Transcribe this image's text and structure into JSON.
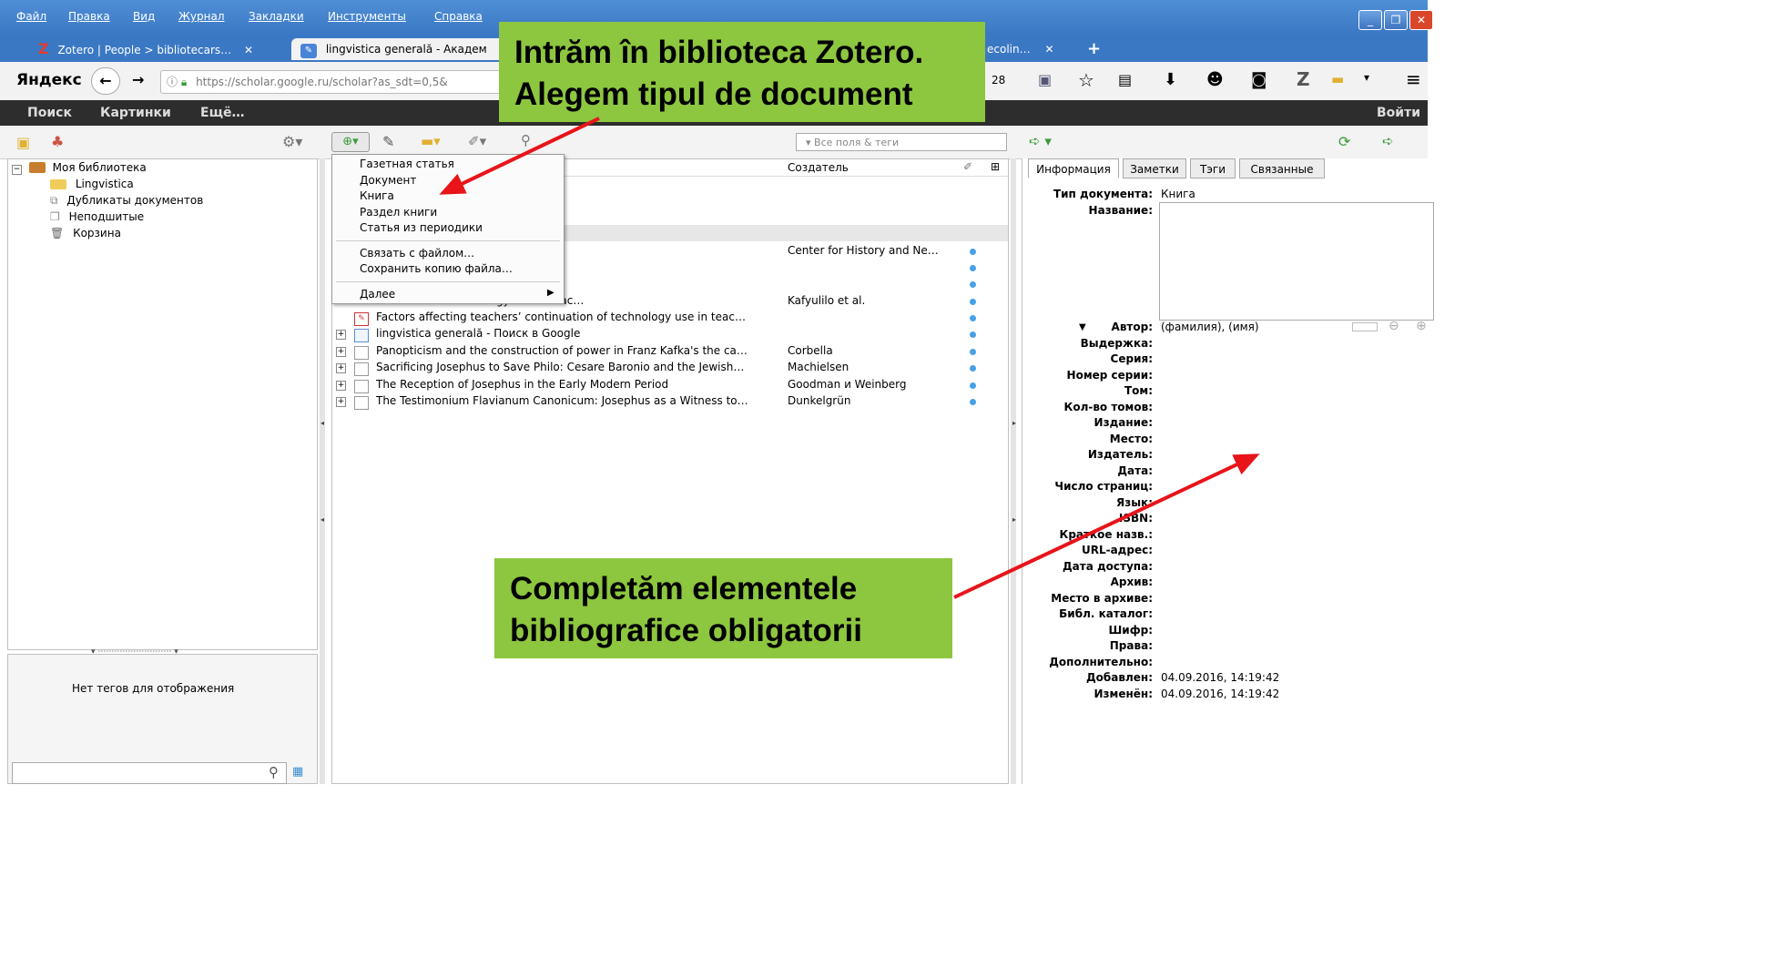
{
  "menubar": {
    "items": [
      "Файл",
      "Правка",
      "Вид",
      "Журнал",
      "Закладки",
      "Инструменты",
      "Справка"
    ]
  },
  "tabs": [
    {
      "label": "Zotero | People > bibliotecars…"
    },
    {
      "label": "lingvistica generală - Академ"
    },
    {
      "label": "ecolin…"
    }
  ],
  "navbar": {
    "brand": "Яндекс",
    "url": "https://scholar.google.ru/scholar?as_sdt=0,5&",
    "count": "28"
  },
  "google_bar": {
    "links": [
      "Поиск",
      "Картинки",
      "Ещё…"
    ],
    "signin": "Войти"
  },
  "zotero_toolbar": {
    "search_placeholder": "Все поля & теги"
  },
  "library": {
    "root": "Моя библиотека",
    "items": [
      "Lingvistica",
      "Дубликаты документов",
      "Неподшитые",
      "Корзина"
    ]
  },
  "tags": {
    "empty_text": "Нет тегов для отображения"
  },
  "columns": {
    "creator": "Создатель"
  },
  "dropdown": {
    "items": [
      "Газетная статья",
      "Документ",
      "Книга",
      "Раздел книги",
      "Статья из периодики"
    ],
    "attach_items": [
      "Связать с файлом…",
      "Сохранить копию файла…"
    ],
    "more": "Далее"
  },
  "items": [
    {
      "title": "",
      "creator": "Center for History and Ne…",
      "attach": true
    },
    {
      "title": "",
      "creator": "",
      "attach": true
    },
    {
      "title": "…inuation of technology use in teac…",
      "creator": "Kafyulilo et al.",
      "attach": true
    },
    {
      "title": "Factors affecting teachers’ continuation of technology use in teac…",
      "creator": "",
      "attach": true
    },
    {
      "title": "lingvistica generală - Поиск в Google",
      "creator": "",
      "attach": true
    },
    {
      "title": "Panopticism and the construction of power in Franz Kafka's the ca…",
      "creator": "Corbella",
      "attach": true
    },
    {
      "title": "Sacrificing Josephus to Save Philo: Cesare Baronio and the Jewish…",
      "creator": "Machielsen",
      "attach": true
    },
    {
      "title": "The Reception of Josephus in the Early Modern Period",
      "creator": "Goodman и Weinberg",
      "attach": true
    },
    {
      "title": "The Testimonium Flavianum Canonicum: Josephus as a Witness to…",
      "creator": "Dunkelgrün",
      "attach": true
    }
  ],
  "right_tabs": [
    "Информация",
    "Заметки",
    "Тэги",
    "Связанные"
  ],
  "fields": {
    "doc_type_label": "Тип документа:",
    "doc_type_value": "Книга",
    "title_label": "Название:",
    "author_label": "Автор:",
    "author_value": "(фамилия), (имя)",
    "labels": [
      "Выдержка:",
      "Серия:",
      "Номер серии:",
      "Том:",
      "Кол-во томов:",
      "Издание:",
      "Место:",
      "Издатель:",
      "Дата:",
      "Число страниц:",
      "Язык:",
      "ISBN:",
      "Краткое назв.:",
      "URL-адрес:",
      "Дата доступа:",
      "Архив:",
      "Место в архиве:",
      "Библ. каталог:",
      "Шифр:",
      "Права:",
      "Дополнительно:"
    ],
    "added_label": "Добавлен:",
    "added_value": "04.09.2016, 14:19:42",
    "modified_label": "Изменён:",
    "modified_value": "04.09.2016, 14:19:42"
  },
  "annotations": {
    "top": [
      "Intrăm în biblioteca Zotero.",
      "Alegem tipul de document"
    ],
    "bottom": [
      "Completăm elementele",
      "bibliografice obligatorii"
    ]
  }
}
